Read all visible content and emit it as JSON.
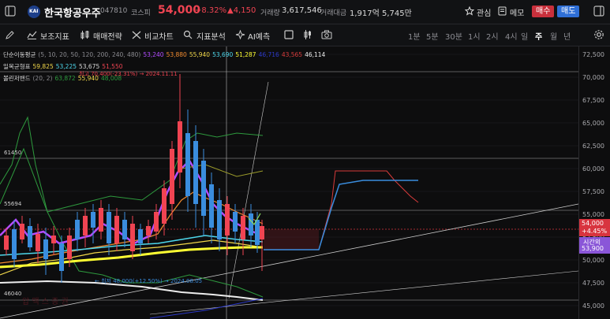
{
  "header": {
    "stock_name": "한국항공우주",
    "stock_code": "047810",
    "market": "코스피",
    "price": "54,000",
    "change_pct": "+8.32%",
    "change_amt": "▲4,150",
    "volume_label": "거래량",
    "volume": "3,617,546",
    "value_label": "거래대금",
    "value": "1,917억 5,745만",
    "watch_label": "관심",
    "memo_label": "메모",
    "buy_label": "매수",
    "sell_label": "매도",
    "logo_text": "KAI"
  },
  "toolbar": {
    "indicators": "보조지표",
    "strategy": "매매전략",
    "compare": "비교차트",
    "analysis": "지표분석",
    "ai_predict": "AI예측",
    "timeframes": [
      "1분",
      "5분",
      "30분",
      "1시",
      "2시",
      "4시",
      "일",
      "주",
      "월",
      "년"
    ],
    "active_timeframe": "주"
  },
  "legend": {
    "ma_label": "단순이동평균",
    "ma_params": "(5, 10, 20, 50, 120, 200, 240, 480)",
    "ma_values": [
      "53,240",
      "53,880",
      "55,940",
      "53,690",
      "51,287",
      "46,716",
      "43,565",
      "46,114"
    ],
    "ichimoku_label": "일목균형표",
    "ichimoku_values": [
      "59,825",
      "53,225",
      "53,675",
      "51,550"
    ],
    "bb_label": "볼린저밴드",
    "bb_params": "(20, 2)",
    "bb_values": [
      "63,872",
      "55,940",
      "48,008"
    ]
  },
  "annotations": {
    "high": "최고 70,400(-23.31%) → 2024.11.11",
    "low": "← 최저 48,000(+12.50%) → 2024.08.05",
    "level_1": "61450",
    "level_2": "55694",
    "level_3": "46040",
    "watermark": "압 맥 스 증 권"
  },
  "price_axis": {
    "ticks": [
      "72,500",
      "70,000",
      "67,500",
      "65,000",
      "62,500",
      "60,000",
      "57,500",
      "55,000",
      "52,500",
      "50,000",
      "47,500",
      "45,000"
    ],
    "current_price": "54,000",
    "current_pct": "+4.45%",
    "ext_label": "시간외",
    "ext_price": "53,900"
  },
  "colors": {
    "up": "#f04452",
    "down": "#3a8dde",
    "accent": "#e8434f",
    "sell_blue": "#2f6fd6"
  }
}
